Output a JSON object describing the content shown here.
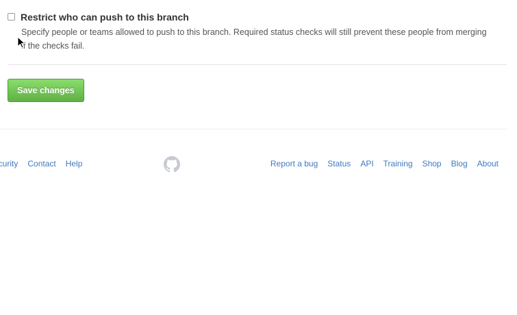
{
  "restrict": {
    "title": "Restrict who can push to this branch",
    "description_line1": "Specify people or teams allowed to push to this branch. Required status checks will still prevent these people from merging",
    "description_line2": "if the checks fail.",
    "checked": false
  },
  "actions": {
    "save_label": "Save changes"
  },
  "footer": {
    "left_links": [
      {
        "label": "Security"
      },
      {
        "label": "Contact"
      },
      {
        "label": "Help"
      }
    ],
    "logo_icon": "github-mark-icon",
    "right_links": [
      {
        "label": "Report a bug"
      },
      {
        "label": "Status"
      },
      {
        "label": "API"
      },
      {
        "label": "Training"
      },
      {
        "label": "Shop"
      },
      {
        "label": "Blog"
      },
      {
        "label": "About"
      }
    ]
  },
  "colors": {
    "link": "#4078c0",
    "save_button": "#60b044",
    "heading_text": "#333333",
    "logo": "#c6cbd1"
  }
}
